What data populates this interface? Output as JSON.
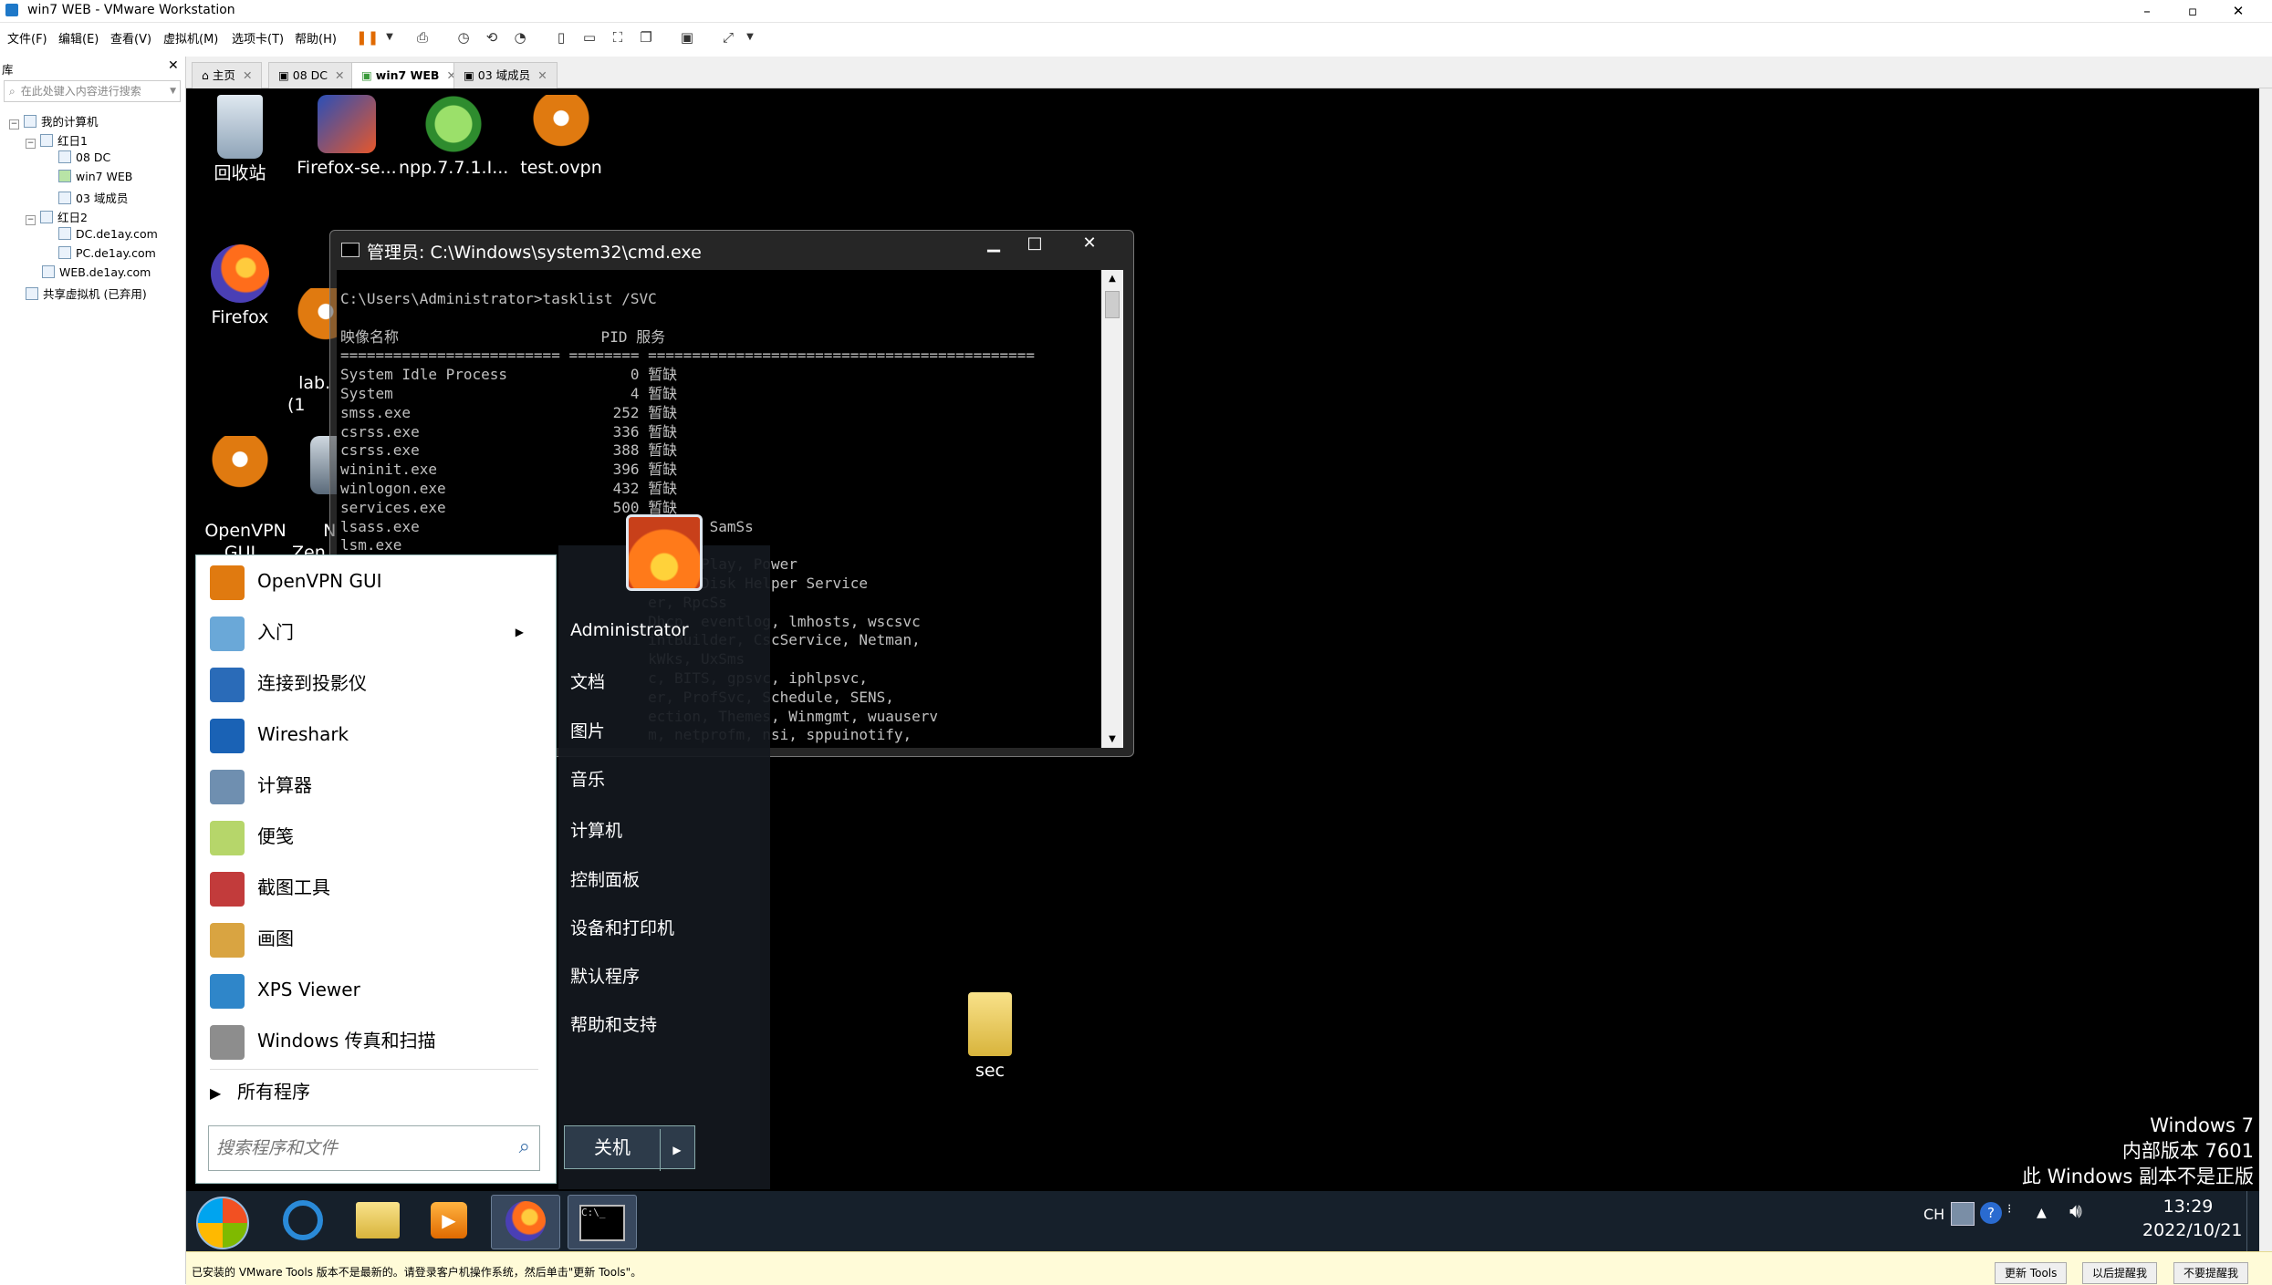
{
  "vmware": {
    "title": "win7 WEB - VMware Workstation",
    "window_controls": [
      "–",
      "▫",
      "✕"
    ],
    "menu": [
      "文件(F)",
      "编辑(E)",
      "查看(V)",
      "虚拟机(M)",
      "选项卡(T)",
      "帮助(H)"
    ],
    "library": {
      "header": "库",
      "search_placeholder": "在此处键入内容进行搜索",
      "tree": [
        {
          "label": "我的计算机",
          "level": 0
        },
        {
          "label": "红日1",
          "level": 1
        },
        {
          "label": "08 DC",
          "level": 2
        },
        {
          "label": "win7 WEB",
          "level": 2
        },
        {
          "label": "03 域成员",
          "level": 2
        },
        {
          "label": "红日2",
          "level": 1
        },
        {
          "label": "DC.de1ay.com",
          "level": 2
        },
        {
          "label": "PC.de1ay.com",
          "level": 2
        },
        {
          "label": "WEB.de1ay.com",
          "level": 1
        },
        {
          "label": "共享虚拟机 (已弃用)",
          "level": 0
        }
      ]
    },
    "tabs": [
      "主页",
      "08 DC",
      "win7 WEB",
      "03 域成员"
    ],
    "active_tab": "win7 WEB",
    "status": {
      "message": "已安装的 VMware Tools 版本不是最新的。请登录客户机操作系统，然后单击\"更新 Tools\"。",
      "buttons": [
        "更新 Tools",
        "以后提醒我",
        "不要提醒我"
      ]
    }
  },
  "desktop": {
    "icons": [
      {
        "label": "回收站"
      },
      {
        "label": "Firefox-se..."
      },
      {
        "label": "npp.7.7.1.I..."
      },
      {
        "label": "test.ovpn"
      },
      {
        "label": "Firefox"
      },
      {
        "label": "lab.\n(1"
      },
      {
        "label": "OpenVPN\nGUI"
      },
      {
        "label": "N\nZen"
      },
      {
        "label": "sec"
      }
    ],
    "watermark": [
      "Windows 7",
      "内部版本 7601",
      "此 Windows 副本不是正版"
    ]
  },
  "cmd": {
    "title": "管理员: C:\\Windows\\system32\\cmd.exe",
    "lines": [
      "C:\\Users\\Administrator>tasklist /SVC",
      "",
      "映像名称                       PID 服务",
      "========================= ======== ============================================",
      "System Idle Process              0 暂缺",
      "System                           4 暂缺",
      "smss.exe                       252 暂缺",
      "csrss.exe                      336 暂缺",
      "csrss.exe                      388 暂缺",
      "wininit.exe                    396 暂缺",
      "winlogon.exe                   432 暂缺",
      "services.exe                   500 暂缺",
      "lsass.exe                          logon, SamSs",
      "lsm.exe",
      "                                   , PlugPlay, Power",
      "                                   sical Disk Helper Service",
      "                                   er, RpcSs",
      "                                   Dhcp, eventlog, lmhosts, wscsvc",
      "                                   intBuilder, CscService, Netman,",
      "                                   kWks, UxSms",
      "                                   c, BITS, gpsvc, iphlpsvc,",
      "                                   er, ProfSvc, Schedule, SENS,",
      "                                   ection, Themes, Winmgmt, wuauserv",
      "                                   m, netprofm, nsi, sppuinotify,"
    ]
  },
  "start_menu": {
    "programs": [
      {
        "label": "OpenVPN GUI",
        "icon": "openvpn-icon",
        "color": "#e07a10"
      },
      {
        "label": "入门",
        "icon": "getting-started-icon",
        "color": "#6aa8d8",
        "submenu": true
      },
      {
        "label": "连接到投影仪",
        "icon": "projector-icon",
        "color": "#2a6bb8"
      },
      {
        "label": "Wireshark",
        "icon": "wireshark-icon",
        "color": "#1a62b5"
      },
      {
        "label": "计算器",
        "icon": "calculator-icon",
        "color": "#6f8fb0"
      },
      {
        "label": "便笺",
        "icon": "sticky-notes-icon",
        "color": "#b6d66a"
      },
      {
        "label": "截图工具",
        "icon": "snipping-tool-icon",
        "color": "#c23b3b"
      },
      {
        "label": "画图",
        "icon": "paint-icon",
        "color": "#d9a441"
      },
      {
        "label": "XPS Viewer",
        "icon": "xps-viewer-icon",
        "color": "#2f86c9"
      },
      {
        "label": "Windows 传真和扫描",
        "icon": "fax-scan-icon",
        "color": "#8d8d8d"
      }
    ],
    "all_programs": "所有程序",
    "search_placeholder": "搜索程序和文件",
    "places": [
      "Administrator",
      "文档",
      "图片",
      "音乐",
      "计算机",
      "控制面板",
      "设备和打印机",
      "默认程序",
      "帮助和支持"
    ],
    "shutdown": "关机"
  },
  "taskbar": {
    "tray": {
      "lang": "CH",
      "time": "13:29",
      "date": "2022/10/21"
    }
  },
  "colors": {
    "desktop_bg": "#000000",
    "taskbar_bg": "#16202b",
    "status_bar_bg": "#fffbd8",
    "accent_orange": "#e06a00"
  }
}
